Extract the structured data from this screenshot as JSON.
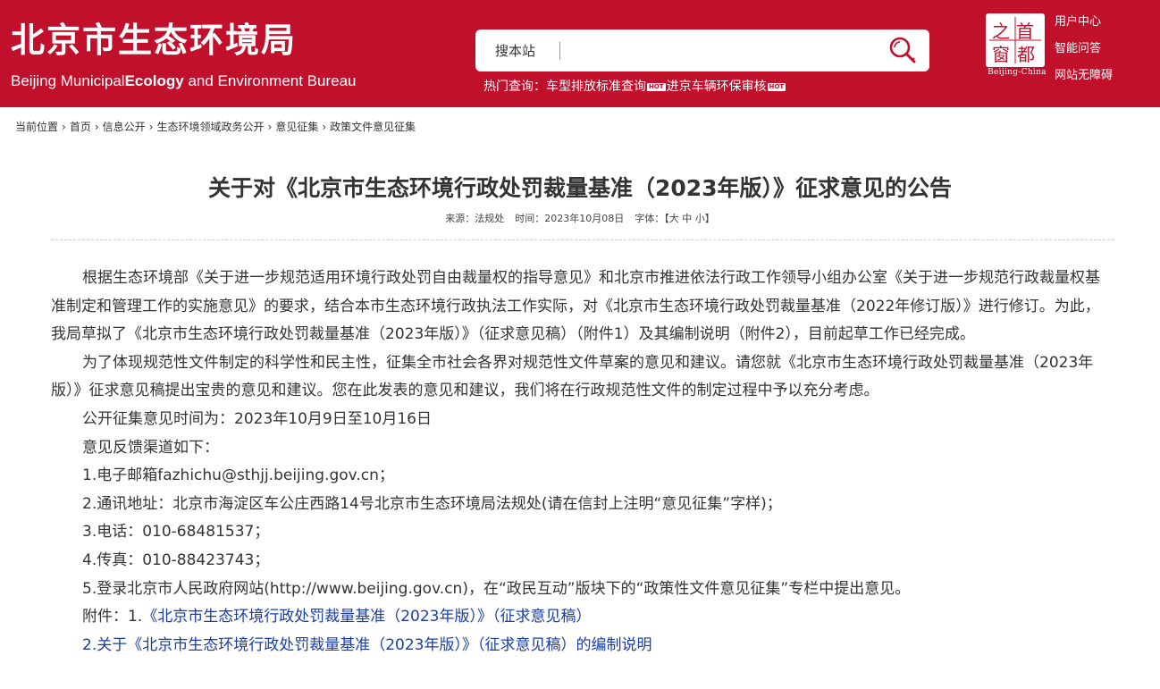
{
  "header": {
    "title": "北京市生态环境局",
    "subtitle_a": "Beijing Municipal",
    "subtitle_b": "Ecology",
    "subtitle_c": "and Environment Bureau",
    "search_label": "搜本站",
    "search_placeholder": "",
    "hot_label": "热门查询：",
    "hot_links": [
      "车型排放标准查询",
      "进京车辆环保审核"
    ],
    "hot_badge": "HOT",
    "logo_chars": [
      "首",
      "都",
      "之",
      "窗"
    ],
    "logo_caption": "Beijing-China",
    "top_links": [
      "用户中心",
      "智能问答",
      "网站无障碍"
    ]
  },
  "breadcrumb": [
    "当前位置",
    "首页",
    "信息公开",
    "生态环境领域政务公开",
    "意见征集",
    "政策文件意见征集"
  ],
  "article": {
    "title": "关于对《北京市生态环境行政处罚裁量基准（2023年版）》征求意见的公告",
    "meta_source": "来源：法规处",
    "meta_time": "时间：2023年10月08日",
    "meta_fontsize_label": "字体：",
    "meta_fontsize_options": "【大 中 小】",
    "para1": "根据生态环境部《关于进一步规范适用环境行政处罚自由裁量权的指导意见》和北京市推进依法行政工作领导小组办公室《关于进一步规范行政裁量权基准制定和管理工作的实施意见》的要求，结合本市生态环境行政执法工作实际，对《北京市生态环境行政处罚裁量基准（2022年修订版）》进行修订。为此，我局草拟了《北京市生态环境行政处罚裁量基准（2023年版）》（征求意见稿）（附件1）及其编制说明（附件2），目前起草工作已经完成。",
    "para2": "为了体现规范性文件制定的科学性和民主性，征集全市社会各界对规范性文件草案的意见和建议。请您就《北京市生态环境行政处罚裁量基准（2023年版）》征求意见稿提出宝贵的意见和建议。您在此发表的意见和建议，我们将在行政规范性文件的制定过程中予以充分考虑。",
    "period": "公开征集意见时间为：2023年10月9日至10月16日",
    "channels_intro": "意见反馈渠道如下：",
    "channel1": "1.电子邮箱fazhichu@sthjj.beijing.gov.cn；",
    "channel2": "2.通讯地址：北京市海淀区车公庄西路14号北京市生态环境局法规处(请在信封上注明“意见征集”字样)；",
    "channel3": "3.电话：010-68481537；",
    "channel4": "4.传真：010-88423743；",
    "channel5": "5.登录北京市人民政府网站(http://www.beijing.gov.cn)，在“政民互动”版块下的“政策性文件意见征集”专栏中提出意见。",
    "attach_prefix": "附件：1.",
    "attach1": "《北京市生态环境行政处罚裁量基准（2023年版）》（征求意见稿）",
    "attach2": "2.关于《北京市生态环境行政处罚裁量基准（2023年版）》（征求意见稿）的编制说明"
  },
  "colors": {
    "brand_red": "#c0102c",
    "link_blue": "#1a3ea8",
    "text": "#333333"
  }
}
